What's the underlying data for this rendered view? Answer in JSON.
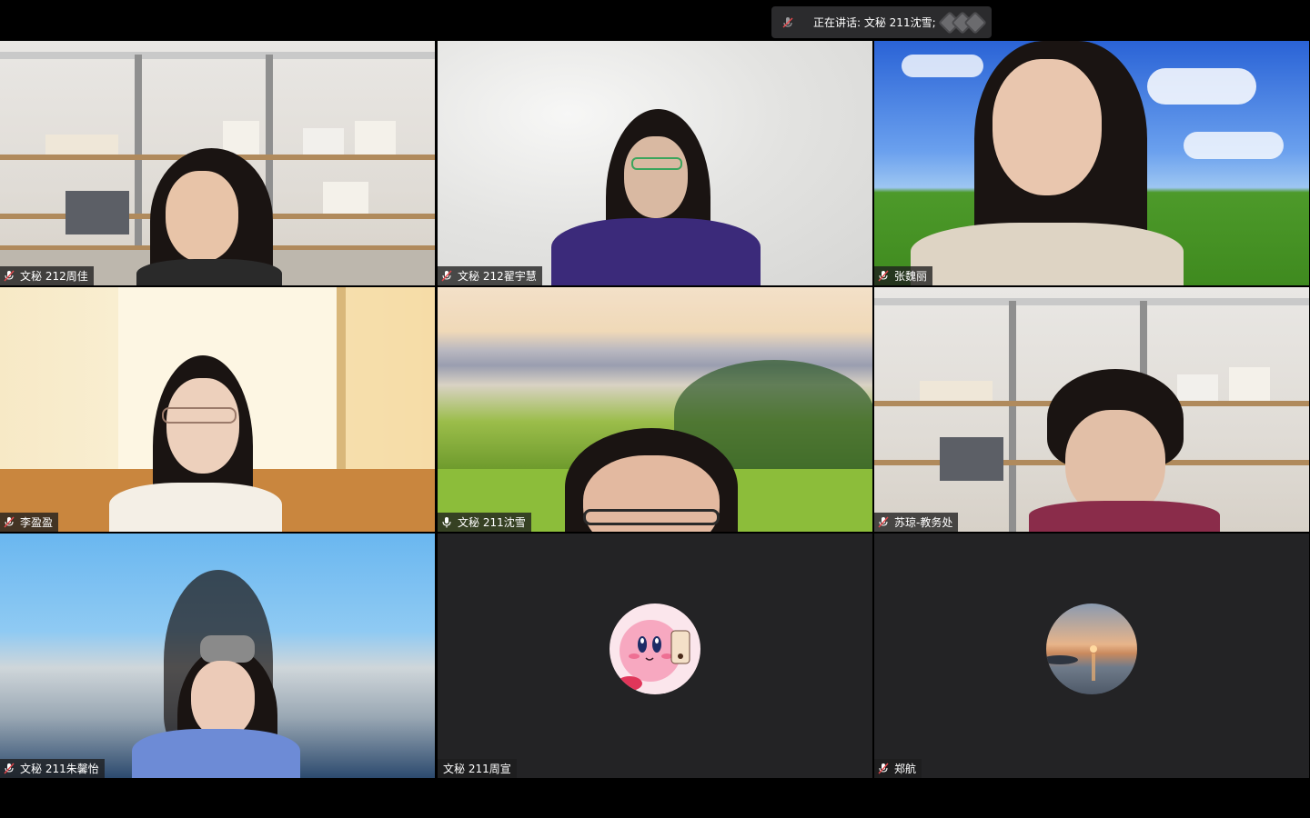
{
  "speaking": {
    "label": "正在讲话: 文秘 211沈雪;"
  },
  "participants": [
    {
      "name": "文秘 212周佳",
      "muted": true
    },
    {
      "name": "文秘 212翟宇慧",
      "muted": true
    },
    {
      "name": "张魏丽",
      "muted": true
    },
    {
      "name": "李盈盈",
      "muted": true
    },
    {
      "name": "文秘 211沈雪",
      "muted": false,
      "active": true
    },
    {
      "name": "苏琼-教务处",
      "muted": true
    },
    {
      "name": "文秘 211朱馨怡",
      "muted": true
    },
    {
      "name": "文秘 211周宣",
      "muted": null,
      "video_off": true
    },
    {
      "name": "郑航",
      "muted": true,
      "video_off": true
    }
  ],
  "colors": {
    "active_border": "#23d959",
    "muted_mic": "#e5484d",
    "tile_bg": "#232325"
  }
}
